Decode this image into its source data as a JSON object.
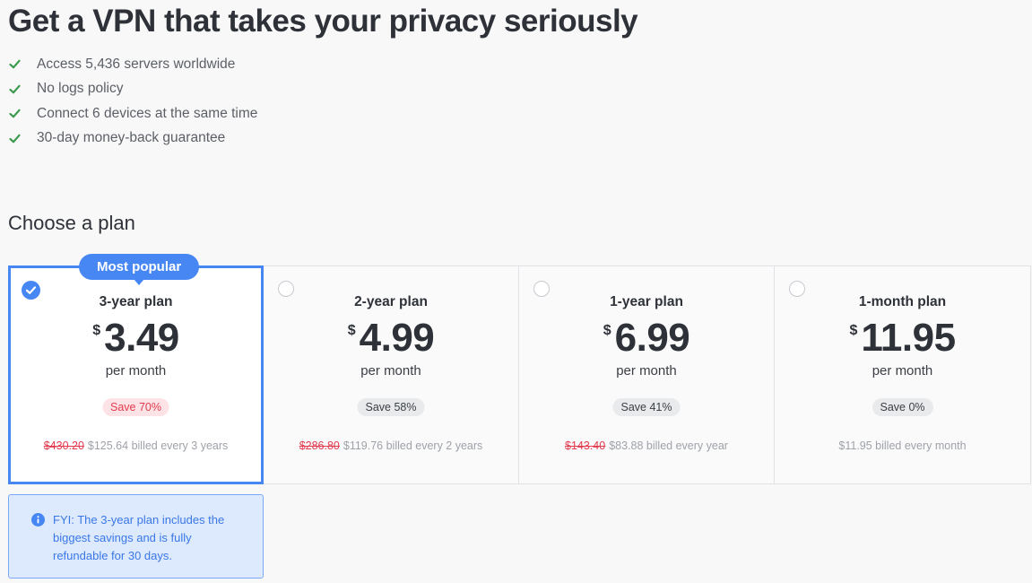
{
  "header": {
    "title": "Get a VPN that takes your privacy seriously",
    "features": [
      "Access 5,436 servers worldwide",
      "No logs policy",
      "Connect 6 devices at the same time",
      "30-day money-back guarantee"
    ]
  },
  "plan_section": {
    "title": "Choose a plan",
    "popular_badge": "Most popular",
    "plans": [
      {
        "name": "3-year plan",
        "currency": "$",
        "price": "3.49",
        "period": "per month",
        "save": "Save 70%",
        "original": "$430.20",
        "billed": "$125.64 billed every 3 years",
        "selected": true
      },
      {
        "name": "2-year plan",
        "currency": "$",
        "price": "4.99",
        "period": "per month",
        "save": "Save 58%",
        "original": "$286.80",
        "billed": "$119.76 billed every 2 years",
        "selected": false
      },
      {
        "name": "1-year plan",
        "currency": "$",
        "price": "6.99",
        "period": "per month",
        "save": "Save 41%",
        "original": "$143.40",
        "billed": "$83.88 billed every year",
        "selected": false
      },
      {
        "name": "1-month plan",
        "currency": "$",
        "price": "11.95",
        "period": "per month",
        "save": "Save 0%",
        "original": "",
        "billed": "$11.95 billed every month",
        "selected": false
      }
    ]
  },
  "fyi": {
    "text": "FYI: The 3-year plan includes the biggest savings and is fully refundable for 30 days."
  },
  "colors": {
    "accent": "#4687f4",
    "check": "#3a9a4b",
    "save_selected": "#e23b4e",
    "strike": "#e23b4e",
    "fyi_background": "#dde9fd"
  },
  "icons": {
    "feature": "check-icon",
    "selected_plan": "checkmark-circle-icon",
    "fyi": "info-icon"
  }
}
